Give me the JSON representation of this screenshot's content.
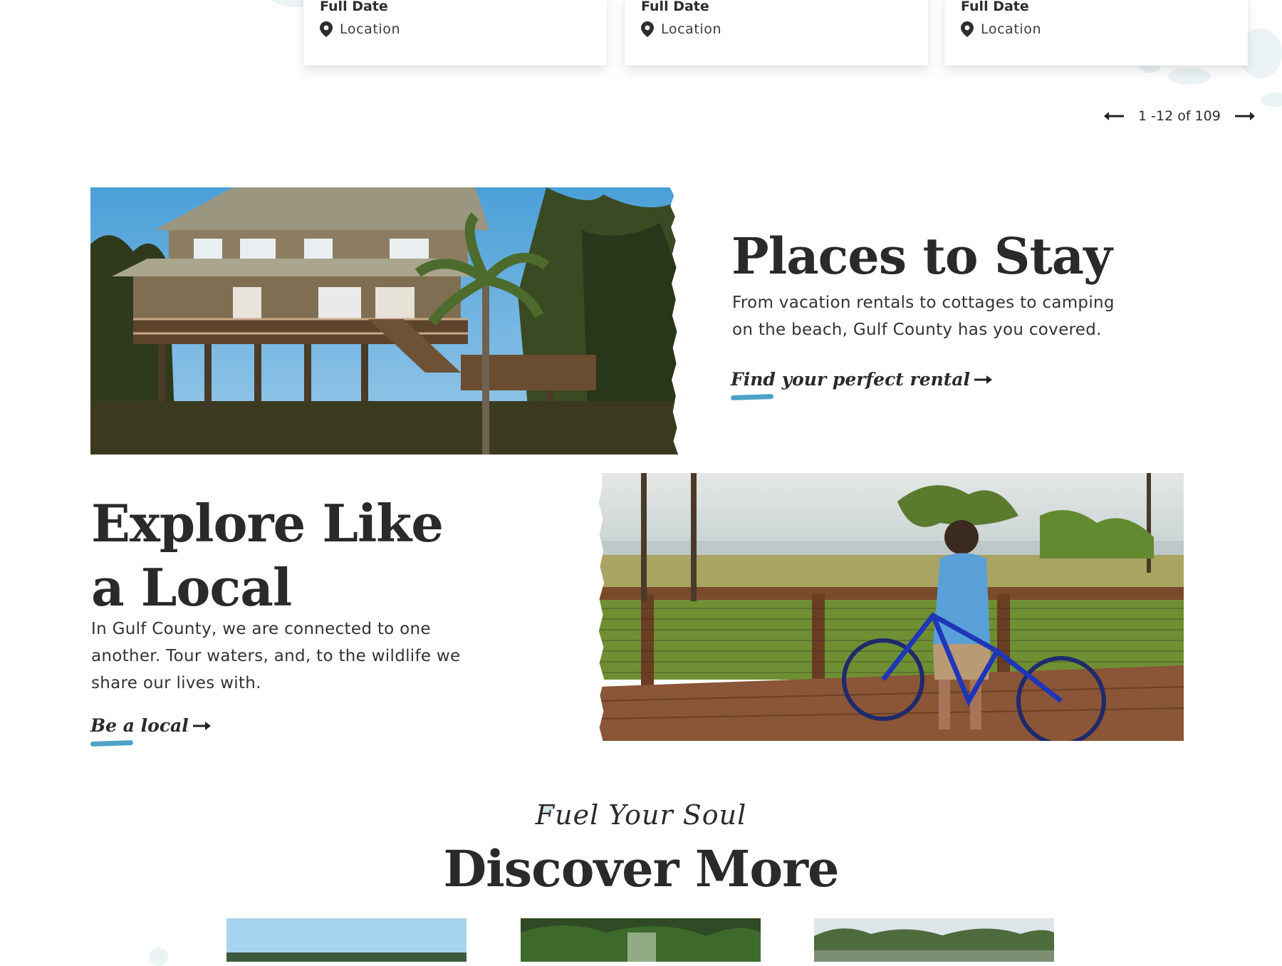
{
  "events": {
    "cards": [
      {
        "date": "Full Date",
        "location": "Location"
      },
      {
        "date": "Full Date",
        "location": "Location"
      },
      {
        "date": "Full Date",
        "location": "Location"
      }
    ],
    "pagination": {
      "label": "1 -12 of 109"
    }
  },
  "stay": {
    "title": "Places to Stay",
    "body": "From vacation rentals to cottages to camping on the beach, Gulf County has you covered.",
    "cta": "Find your perfect rental"
  },
  "explore": {
    "title": "Explore Like a Local",
    "body": "In Gulf County, we are connected to one another. Tour waters, and, to the wildlife we share our lives with.",
    "cta": "Be a local"
  },
  "discover": {
    "eyebrow": "Fuel Your Soul",
    "title": "Discover More"
  },
  "colors": {
    "accent": "#4fa2c7",
    "text": "#2a2a2a",
    "splash": "#dbe9ec"
  },
  "icons": [
    "location-pin-icon",
    "arrow-left-icon",
    "arrow-right-icon"
  ]
}
